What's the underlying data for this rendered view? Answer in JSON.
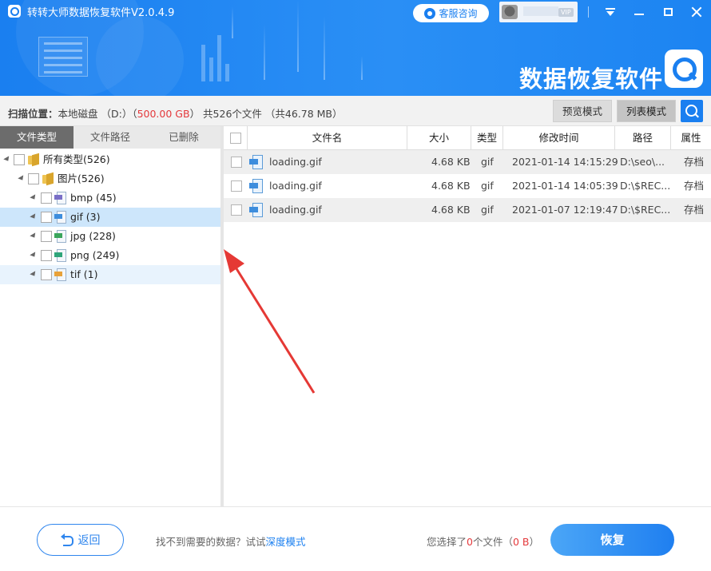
{
  "titlebar": {
    "app_title": "转转大师数据恢复软件V2.0.4.9",
    "service_label": "客服咨询",
    "vip_label": "VIP"
  },
  "banner": {
    "brand_text": "数据恢复软件"
  },
  "infobar": {
    "scan_label": "扫描位置：",
    "scan_disk": "本地磁盘 （D:）（",
    "scan_size": "500.00 GB",
    "scan_tail": "） 共526个文件 （共46.78 MB）",
    "preview_mode": "预览模式",
    "list_mode": "列表模式"
  },
  "tabs": [
    {
      "label": "文件类型"
    },
    {
      "label": "文件路径"
    },
    {
      "label": "已删除"
    }
  ],
  "tree": [
    {
      "label": "所有类型(526)",
      "icon": "folder-icon"
    },
    {
      "label": "图片(526)",
      "icon": "folder-icon"
    },
    {
      "label": "bmp (45)",
      "icon": "bmp-file-icon",
      "tag_color": "#7a6fc7"
    },
    {
      "label": "gif (3)",
      "icon": "gif-file-icon",
      "tag_color": "#3d8ddd"
    },
    {
      "label": "jpg (228)",
      "icon": "jpg-file-icon",
      "tag_color": "#3ba55c"
    },
    {
      "label": "png (249)",
      "icon": "png-file-icon",
      "tag_color": "#2fa57a"
    },
    {
      "label": "tif (1)",
      "icon": "tif-file-icon",
      "tag_color": "#e8a23a"
    }
  ],
  "table": {
    "columns": [
      "文件名",
      "大小",
      "类型",
      "修改时间",
      "路径",
      "属性"
    ],
    "rows": [
      {
        "name": "loading.gif",
        "size": "4.68 KB",
        "type": "gif",
        "mtime": "2021-01-14 14:15:29",
        "path": "D:\\seo\\...",
        "attr": "存档"
      },
      {
        "name": "loading.gif",
        "size": "4.68 KB",
        "type": "gif",
        "mtime": "2021-01-14 14:05:39",
        "path": "D:\\$REC...",
        "attr": "存档"
      },
      {
        "name": "loading.gif",
        "size": "4.68 KB",
        "type": "gif",
        "mtime": "2021-01-07 12:19:47",
        "path": "D:\\$REC...",
        "attr": "存档"
      }
    ]
  },
  "footer": {
    "back_label": "返回",
    "hint_prefix": "找不到需要的数据？试试",
    "hint_link": "深度模式",
    "selected_prefix": "您选择了",
    "selected_count": "0",
    "selected_mid": "个文件（",
    "selected_size": "0 B",
    "selected_suffix": "）",
    "recover_label": "恢复"
  },
  "colors": {
    "accent": "#1a7ff0",
    "danger": "#e4393c",
    "annotation_arrow": "#e53935"
  }
}
